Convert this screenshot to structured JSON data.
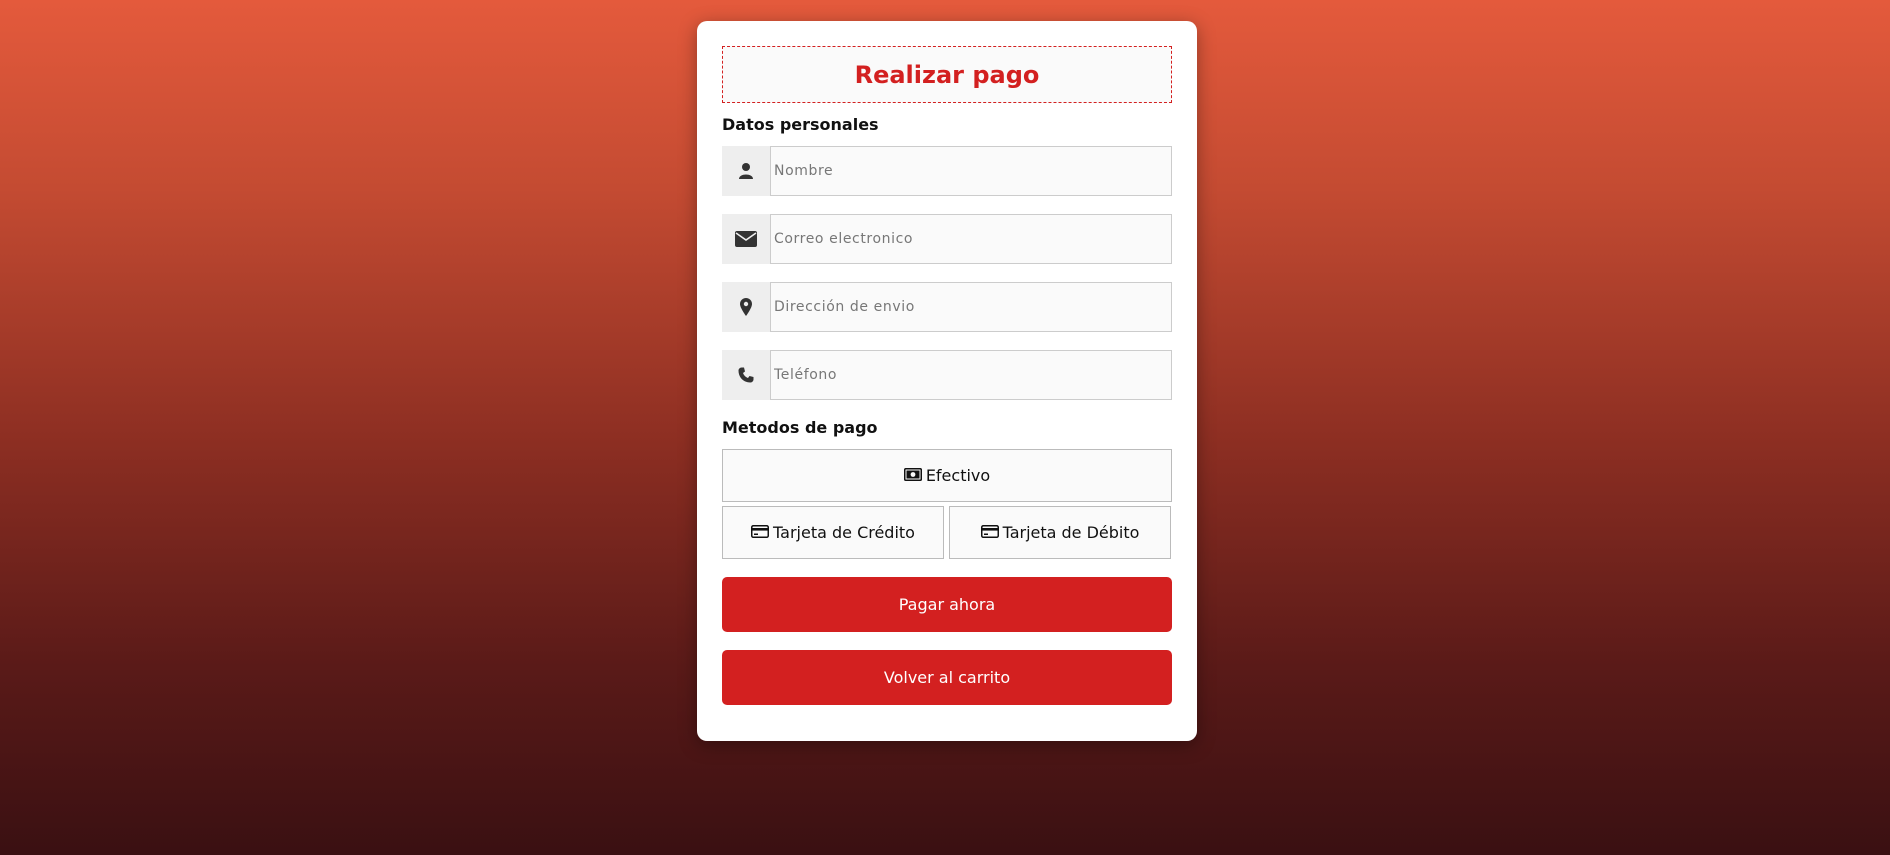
{
  "form": {
    "title": "Realizar pago",
    "personal_section_label": "Datos personales",
    "fields": [
      {
        "icon": "user-icon",
        "placeholder": "Nombre",
        "value": ""
      },
      {
        "icon": "envelope-icon",
        "placeholder": "Correo electronico",
        "value": ""
      },
      {
        "icon": "map-marker-icon",
        "placeholder": "Dirección de envio",
        "value": ""
      },
      {
        "icon": "phone-icon",
        "placeholder": "Teléfono",
        "value": ""
      }
    ],
    "payment_section_label": "Metodos de pago",
    "payment_methods": [
      {
        "icon": "cash-icon",
        "label": "Efectivo"
      },
      {
        "icon": "credit-card-icon",
        "label": "Tarjeta de Crédito"
      },
      {
        "icon": "credit-card-icon",
        "label": "Tarjeta de Débito"
      }
    ],
    "pay_button": "Pagar ahora",
    "back_button": "Volver al carrito"
  },
  "colors": {
    "accent": "#d32020",
    "background_top": "#e45a3c",
    "background_bottom": "#3a1012",
    "card": "#ffffff",
    "input_bg": "#fafafa",
    "icon_bg": "#eeeeee"
  }
}
